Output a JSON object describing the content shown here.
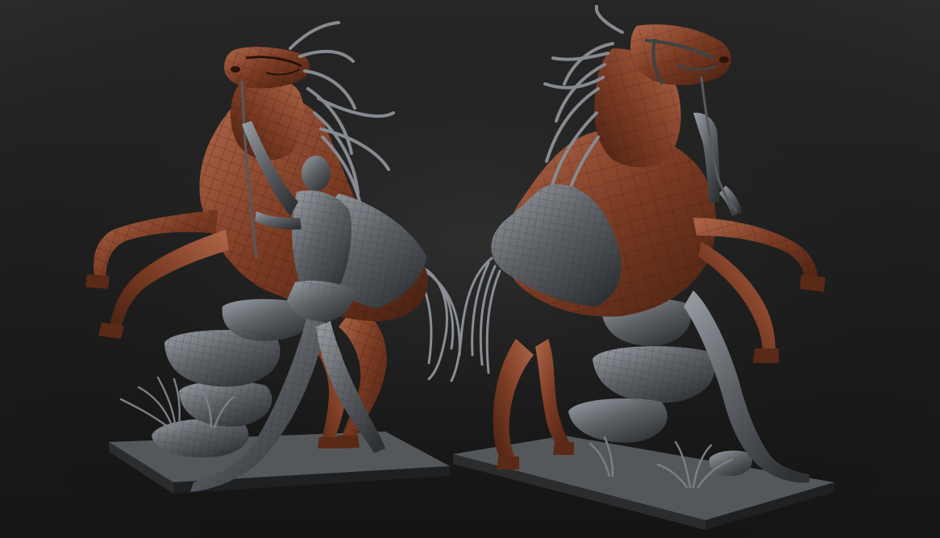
{
  "viewport": {
    "background_top": "#2a2a2a",
    "background_bottom": "#151515"
  },
  "materials": {
    "horse_base": "#7a3a22",
    "horse_light": "#b0674a",
    "horse_dark": "#4a2212",
    "stone_base": "#5d6166",
    "stone_light": "#9aa0a6",
    "stone_dark": "#2f3235",
    "wire": "#1a0c06"
  },
  "scene": {
    "left_model": "horse-and-man",
    "right_model": "horse"
  }
}
